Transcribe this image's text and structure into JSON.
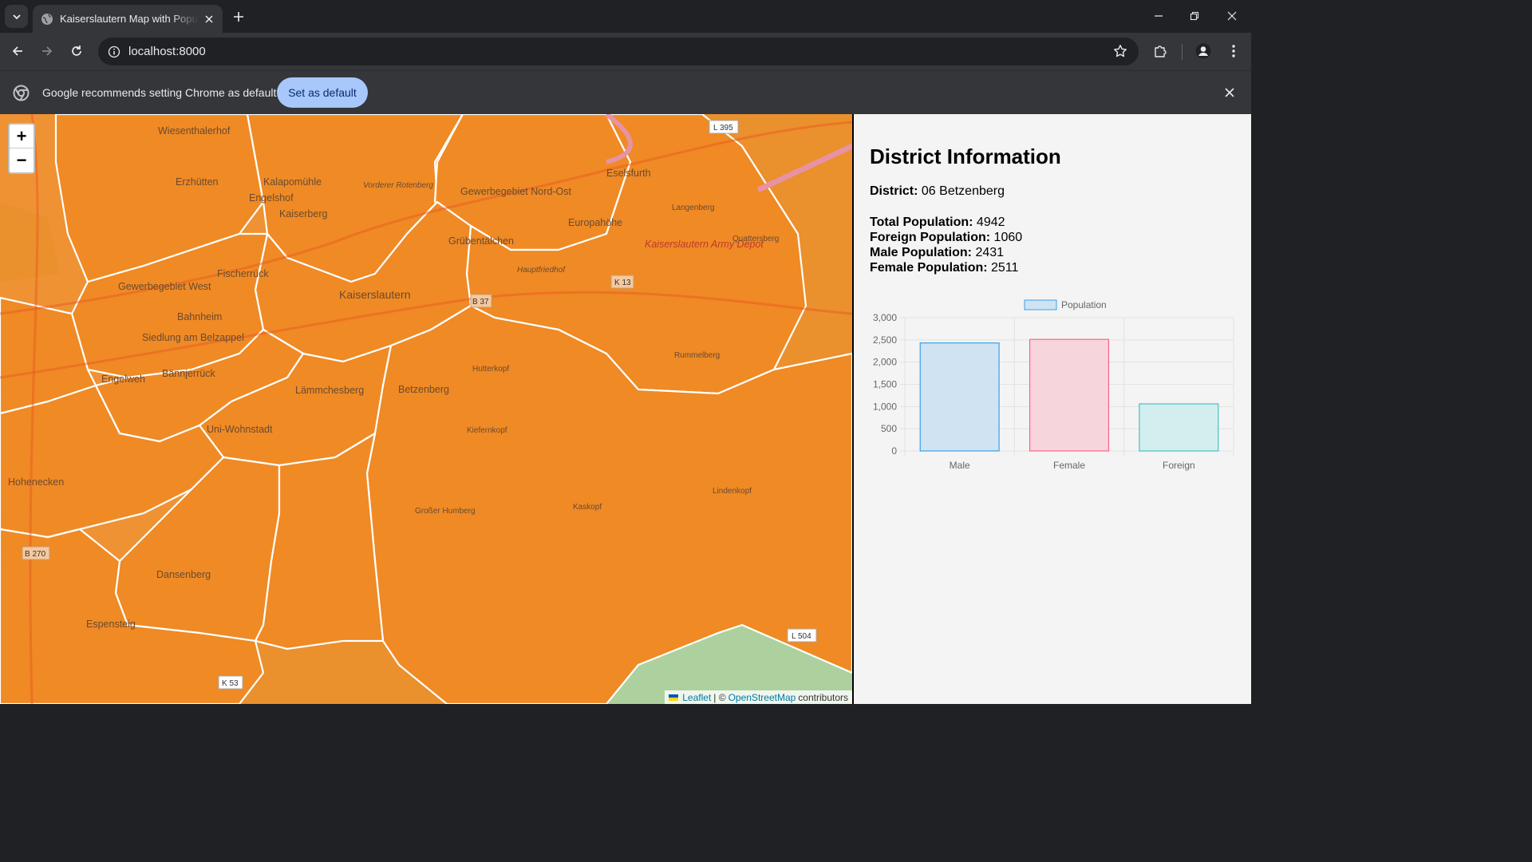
{
  "browser": {
    "tab_title": "Kaiserslautern Map with Population",
    "url": "localhost:8000",
    "infobar_text": "Google recommends setting Chrome as default",
    "infobar_button": "Set as default"
  },
  "map": {
    "zoom_in": "+",
    "zoom_out": "−",
    "attribution": {
      "leaflet": "Leaflet",
      "separator": "| ©",
      "osm": "OpenStreetMap",
      "contributors": "contributors"
    },
    "labels": {
      "wiesenthalerhof": "Wiesenthalerhof",
      "erzhutten": "Erzhütten",
      "kalapomuhle": "Kalapomühle",
      "engelshof": "Engelshof",
      "kaiserberg": "Kaiserberg",
      "vorderer_rotenberg": "Vorderer Rotenberg",
      "gewerbegebiet_nordost": "Gewerbegebiet Nord-Ost",
      "grubentalchen": "Grübentälchen",
      "eselsfurth": "Eselsfurth",
      "europahohe": "Europahöhe",
      "army_depot": "Kaiserslautern Army Depot",
      "fischerruck": "Fischerrück",
      "gewerbegebiet_west": "Gewerbegebiet West",
      "kaiserslautern": "Kaiserslautern",
      "bahnheim": "Bahnheim",
      "siedlung_am_belzappel": "Siedlung am Belzappel",
      "hauptfriedhof": "Hauptfriedhof",
      "bannjerruck": "Bännjerrück",
      "lammchesberg": "Lämmchesberg",
      "betzenberg": "Betzenberg",
      "kotten": "Hutterkopf",
      "engelweh": "Engelweh",
      "uni_wohnstadt": "Uni-Wohnstadt",
      "hohenecken": "Hohenecken",
      "dansenberg": "Dansenberg",
      "espensteig": "Espensteig",
      "kiefernkopf": "Kiefernkopf",
      "grosser_humberg": "Großer Humberg",
      "kaskopf": "Kaskopf",
      "rummelberg": "Rummelberg",
      "lindenkopf": "Lindenkopf",
      "quattersberg": "Quattersberg",
      "langenberg": "Langenberg",
      "l395": "L 395",
      "k13": "K 13",
      "b37": "B 37",
      "b270": "B 270",
      "l504": "L 504",
      "k53": "K 53"
    }
  },
  "district": {
    "heading": "District Information",
    "district_label": "District:",
    "district_value": "06 Betzenberg",
    "total_label": "Total Population:",
    "total_value": "4942",
    "foreign_label": "Foreign Population:",
    "foreign_value": "1060",
    "male_label": "Male Population:",
    "male_value": "2431",
    "female_label": "Female Population:",
    "female_value": "2511"
  },
  "chart_data": {
    "type": "bar",
    "categories": [
      "Male",
      "Female",
      "Foreign"
    ],
    "series": [
      {
        "name": "Population",
        "values": [
          2431,
          2511,
          1060
        ]
      }
    ],
    "ylim": [
      0,
      3000
    ],
    "yticks": [
      0,
      500,
      1000,
      1500,
      2000,
      2500,
      3000
    ],
    "ytick_labels": [
      "0",
      "500",
      "1,000",
      "1,500",
      "2,000",
      "2,500",
      "3,000"
    ],
    "legend_position": "top",
    "grid": true,
    "colors": {
      "fills": [
        "#cfe3f3",
        "#f7d5dd",
        "#d3eeee"
      ],
      "borders": [
        "#36a2eb",
        "#ff6384",
        "#4bc0c0"
      ]
    }
  },
  "colors": {
    "district_fill": "#ef8a24",
    "district_border": "#ffffff",
    "infobar_button": "#a8c7fa"
  }
}
